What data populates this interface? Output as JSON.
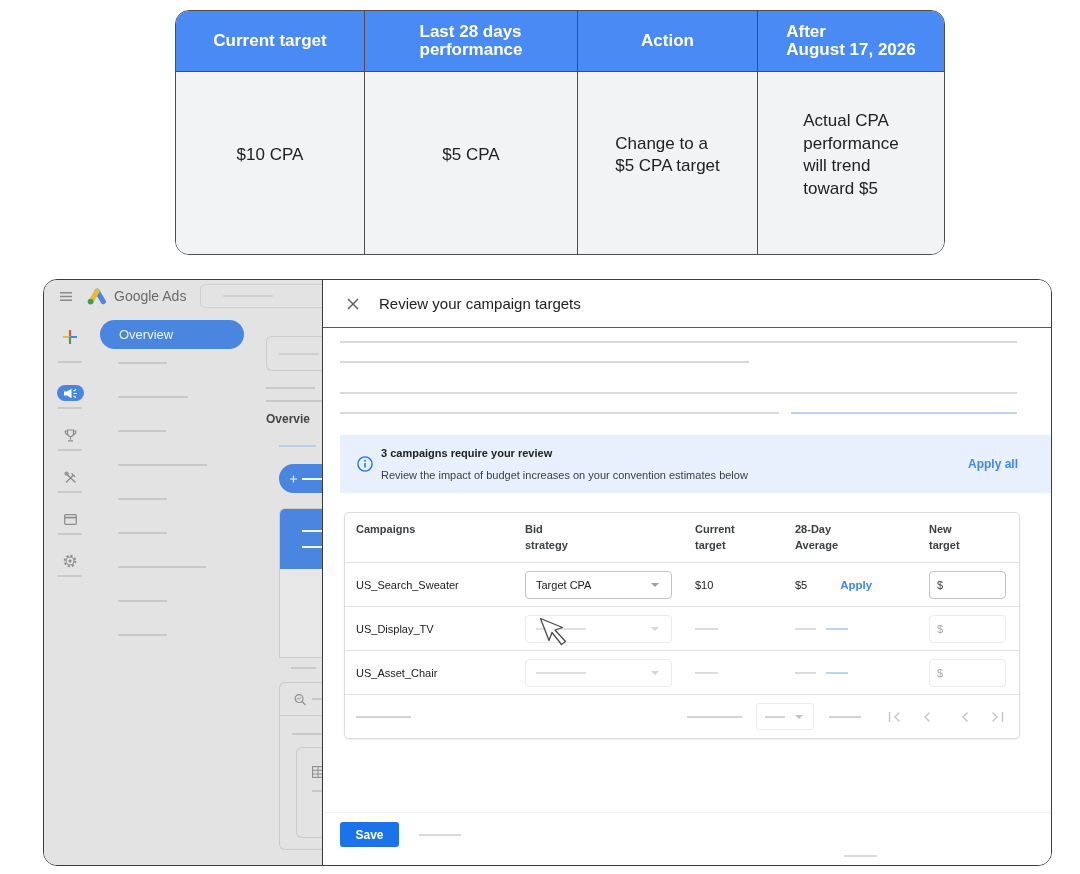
{
  "comparison_table": {
    "columns": [
      "Current target",
      "Last 28 days\nperformance",
      "Action",
      "After\nAugust 17, 2026"
    ],
    "rows": [
      [
        "$10 CPA",
        "$5 CPA",
        "Change to a\n$5 CPA target",
        "Actual CPA\nperformance\nwill trend\ntoward $5"
      ]
    ]
  },
  "app": {
    "brand": "Google Ads",
    "rail": [
      {
        "selected": true
      },
      {
        "selected": false
      },
      {
        "selected": false
      },
      {
        "selected": false
      },
      {
        "selected": false
      }
    ],
    "nav": [
      {
        "label": "Overview",
        "selected": true
      }
    ],
    "page_heading": "Overvie"
  },
  "panel": {
    "title": "Review your campaign targets",
    "banner": {
      "title": "3 campaigns require your review",
      "message": "Review the impact of budget increases on your convention estimates below",
      "action": "Apply all"
    },
    "table": {
      "columns": [
        "Campaigns",
        "Bid\nstrategy",
        "Current\ntarget",
        "28-Day\nAverage",
        "New\ntarget"
      ],
      "rows": [
        {
          "campaign": "US_Search_Sweater",
          "disabled": false,
          "bid_strategy": "Target CPA",
          "current_target": "$10",
          "average": "$5",
          "apply": "Apply",
          "new_target_prefix": "$"
        },
        {
          "campaign": "US_Display_TV",
          "disabled": true,
          "new_target_prefix": "$"
        },
        {
          "campaign": "US_Asset_Chair",
          "disabled": true,
          "new_target_prefix": "$"
        }
      ]
    },
    "save_button": "Save"
  }
}
